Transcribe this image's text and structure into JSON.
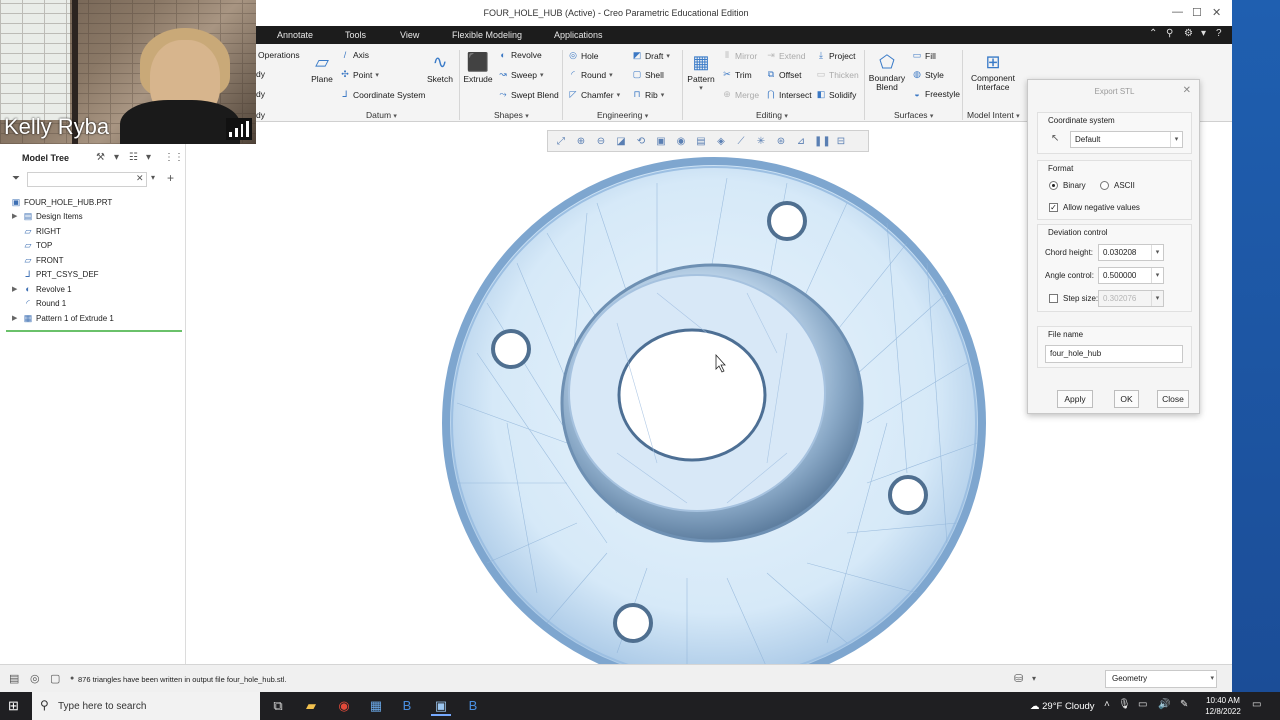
{
  "window": {
    "title": "FOUR_HOLE_HUB (Active) - Creo Parametric Educational Edition"
  },
  "menu_tabs": [
    "Annotate",
    "Tools",
    "View",
    "Flexible Modeling",
    "Applications"
  ],
  "ribbon": {
    "datum": {
      "operations": "Operations",
      "plane": "Plane",
      "axis": "Axis",
      "point": "Point",
      "coordinate_system": "Coordinate System",
      "sketch": "Sketch",
      "label": "Datum"
    },
    "shapes": {
      "extrude": "Extrude",
      "revolve": "Revolve",
      "sweep": "Sweep",
      "swept_blend": "Swept Blend",
      "label": "Shapes"
    },
    "engineering": {
      "hole": "Hole",
      "round": "Round",
      "chamfer": "Chamfer",
      "draft": "Draft",
      "shell": "Shell",
      "rib": "Rib",
      "label": "Engineering"
    },
    "editing": {
      "pattern": "Pattern",
      "mirror": "Mirror",
      "trim": "Trim",
      "merge": "Merge",
      "extend": "Extend",
      "offset": "Offset",
      "intersect": "Intersect",
      "project": "Project",
      "thicken": "Thicken",
      "solidify": "Solidify",
      "label": "Editing"
    },
    "surfaces": {
      "boundary_blend": "Boundary Blend",
      "fill": "Fill",
      "style": "Style",
      "freestyle": "Freestyle",
      "label": "Surfaces"
    },
    "model_intent": {
      "component_interface": "Component Interface",
      "label": "Model Intent"
    },
    "left_clipped": [
      "dy",
      "dy",
      "dy"
    ]
  },
  "webcam": {
    "name": "Kelly Ryba"
  },
  "model_tree": {
    "title": "Model Tree",
    "root": "FOUR_HOLE_HUB.PRT",
    "items": [
      {
        "label": "Design Items",
        "expandable": true
      },
      {
        "label": "RIGHT",
        "expandable": false
      },
      {
        "label": "TOP",
        "expandable": false
      },
      {
        "label": "FRONT",
        "expandable": false
      },
      {
        "label": "PRT_CSYS_DEF",
        "expandable": false
      },
      {
        "label": "Revolve 1",
        "expandable": true
      },
      {
        "label": "Round 1",
        "expandable": false
      },
      {
        "label": "Pattern 1 of Extrude 1",
        "expandable": true
      }
    ]
  },
  "dialog": {
    "title": "Export STL",
    "coordinate_system_label": "Coordinate system",
    "coordinate_system_value": "Default",
    "format_label": "Format",
    "binary": "Binary",
    "ascii": "ASCII",
    "allow_negative": "Allow negative values",
    "deviation_label": "Deviation control",
    "chord_height_label": "Chord height:",
    "chord_height": "0.030208",
    "angle_control_label": "Angle control:",
    "angle_control": "0.500000",
    "step_size_label": "Step size:",
    "step_size": "0.302076",
    "file_name_label": "File name",
    "file_name": "four_hole_hub",
    "apply": "Apply",
    "ok": "OK",
    "close": "Close"
  },
  "status": {
    "message": "876 triangles have been written in output file four_hole_hub.stl.",
    "filter": "Geometry"
  },
  "taskbar": {
    "search_placeholder": "Type here to search",
    "weather": "29°F  Cloudy",
    "time": "10:40 AM",
    "date": "12/8/2022"
  }
}
